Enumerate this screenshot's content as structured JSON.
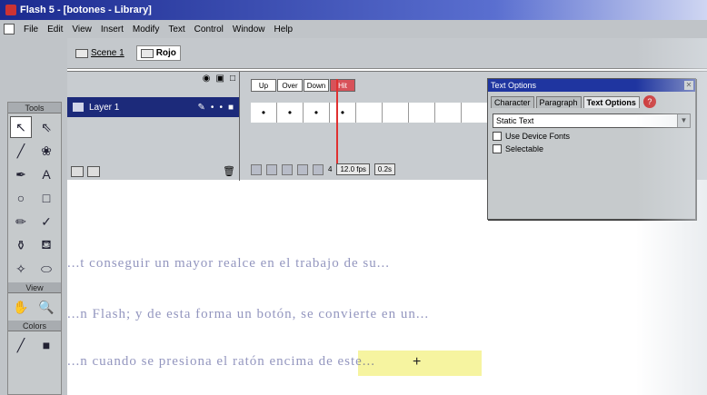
{
  "window": {
    "title": "Flash 5 - [botones - Library]"
  },
  "menu": [
    "File",
    "Edit",
    "View",
    "Insert",
    "Modify",
    "Text",
    "Control",
    "Window",
    "Help"
  ],
  "breadcrumb": {
    "scene": "Scene 1",
    "symbol": "Rojo"
  },
  "toolbox": {
    "header": "Tools",
    "view_header": "View",
    "colors_header": "Colors",
    "tools": [
      "arrow-icon",
      "subselect-icon",
      "line-icon",
      "lasso-icon",
      "pen-icon",
      "text-icon",
      "oval-icon",
      "rectangle-icon",
      "pencil-icon",
      "brush-icon",
      "ink-bottle-icon",
      "paint-bucket-icon",
      "dropper-icon",
      "eraser-icon"
    ],
    "view_tools": [
      "hand-icon",
      "zoom-icon"
    ],
    "color_tools": [
      "stroke-color-icon",
      "fill-color-icon"
    ]
  },
  "timeline": {
    "layer_name": "Layer 1",
    "frame_labels": [
      "Up",
      "Over",
      "Down",
      "Hit"
    ],
    "frame_rate": "12.0 fps",
    "elapsed": "0.2s",
    "current_frame": "4"
  },
  "text_options": {
    "title": "Text Options",
    "tabs": [
      "Character",
      "Paragraph",
      "Text Options"
    ],
    "type": "Static Text",
    "checks": [
      "Use Device Fonts",
      "Selectable"
    ]
  },
  "stage_text": {
    "line1": "...t conseguir un mayor realce en el trabajo de su...",
    "line2": "...n Flash; y de esta forma un botón, se convierte en un...",
    "line3": "...n cuando se presiona el ratón encima de este..."
  },
  "colors": {
    "title_bar": "#1b2a8f",
    "layer_row": "#1c2a7a",
    "hit_label": "#d8525a",
    "playhead": "#e03030",
    "highlight": "#f6f4a0"
  }
}
